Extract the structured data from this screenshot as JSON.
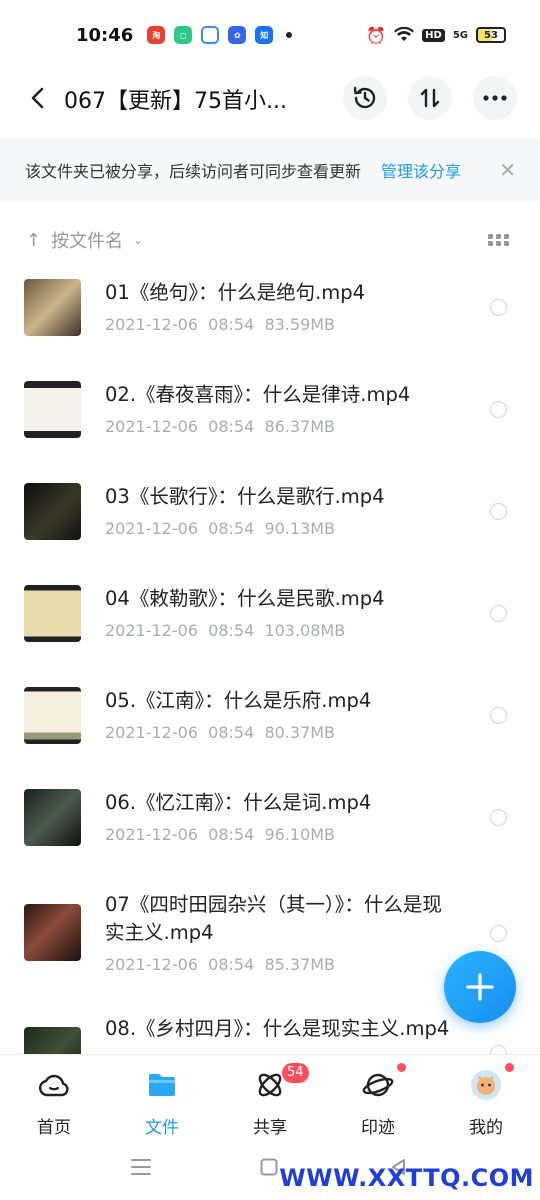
{
  "status_bar": {
    "time": "10:46",
    "battery": "53",
    "network": "5G",
    "hd": "HD"
  },
  "header": {
    "title": "067【更新】75首小..."
  },
  "banner": {
    "text": "该文件夹已被分享，后续访问者可同步查看更新",
    "link": "管理该分享"
  },
  "sort": {
    "label": "按文件名"
  },
  "files": [
    {
      "name": "01《绝句》：什么是绝句.mp4",
      "date": "2021-12-06  08:54",
      "size": "83.59MB"
    },
    {
      "name": "02.《春夜喜雨》：什么是律诗.mp4",
      "date": "2021-12-06  08:54",
      "size": "86.37MB"
    },
    {
      "name": "03《长歌行》：什么是歌行.mp4",
      "date": "2021-12-06  08:54",
      "size": "90.13MB"
    },
    {
      "name": "04《敕勒歌》：什么是民歌.mp4",
      "date": "2021-12-06  08:54",
      "size": "103.08MB"
    },
    {
      "name": "05.《江南》：什么是乐府.mp4",
      "date": "2021-12-06  08:54",
      "size": "80.37MB"
    },
    {
      "name": "06.《忆江南》：什么是词.mp4",
      "date": "2021-12-06  08:54",
      "size": "96.10MB"
    },
    {
      "name": "07《四时田园杂兴（其一）》：什么是现实主义.mp4",
      "date": "2021-12-06  08:54",
      "size": "85.37MB"
    },
    {
      "name": "08.《乡村四月》：什么是现实主义.mp4",
      "date": "",
      "size": ""
    }
  ],
  "nav": {
    "home": "首页",
    "files": "文件",
    "share": "共享",
    "share_badge": "54",
    "moments": "印迹",
    "me": "我的"
  },
  "watermark": "WWW.XXTTQ.COM",
  "colors": {
    "accent": "#1e9af0",
    "badge": "#ff4d5a"
  }
}
